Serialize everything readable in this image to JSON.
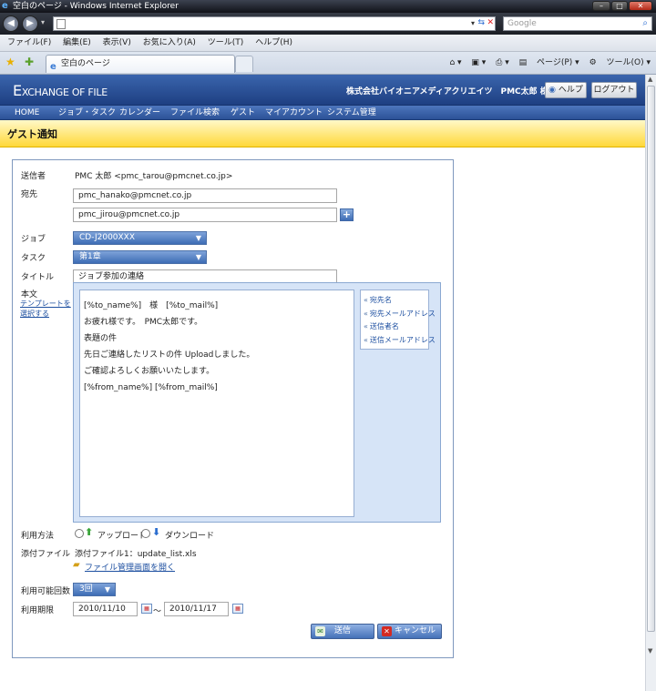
{
  "window": {
    "title": "空白のページ - Windows Internet Explorer"
  },
  "search": {
    "placeholder": "Google"
  },
  "menu": [
    "ファイル(F)",
    "編集(E)",
    "表示(V)",
    "お気に入り(A)",
    "ツール(T)",
    "ヘルプ(H)"
  ],
  "tab": {
    "label": "空白のページ"
  },
  "commandbar": {
    "page": "ページ(P)",
    "tools": "ツール(O)"
  },
  "app": {
    "logo_main": "E",
    "logo_rest": "XCHANGE OF FILE",
    "company": "株式会社バイオニアメディアクリエイツ　PMC太郎 様",
    "help": "ヘルプ",
    "logout": "ログアウト"
  },
  "nav": [
    "HOME",
    "ジョブ・タスク",
    "カレンダー",
    "ファイル検索",
    "ゲスト",
    "マイアカウント",
    "システム管理"
  ],
  "page": {
    "title": "ゲスト通知"
  },
  "form": {
    "sender_label": "送信者",
    "sender_value": "PMC 太郎 <pmc_tarou@pmcnet.co.jp>",
    "to_label": "宛先",
    "to_1": "pmc_hanako@pmcnet.co.jp",
    "to_2": "pmc_jirou@pmcnet.co.jp",
    "job_label": "ジョブ",
    "job_value": "CD-J2000XXX",
    "task_label": "タスク",
    "task_value": "第1章",
    "title_label": "タイトル",
    "title_value": "ジョブ参加の連絡",
    "body_label": "本文",
    "template_link_1": "テンプレートを",
    "template_link_2": "選択する",
    "body_lines": [
      "[%to_name%]　様　[%to_mail%]",
      "お疲れ様です。　PMC太郎です。",
      "表題の件",
      "先日ご連絡したリストの件 Uploadしました。",
      "ご確認よろしくお願いいたします。",
      "[%from_name%] [%from_mail%]"
    ],
    "insert_items": [
      "宛先名",
      "宛先メールアドレス",
      "送信者名",
      "送信メールアドレス"
    ],
    "usage_label": "利用方法",
    "upload": "アップロード",
    "download": "ダウンロード",
    "attach_label": "添付ファイル",
    "attach_value": "添付ファイル1：update_list.xls",
    "file_link": "ファイル管理画面を開く",
    "count_label": "利用可能回数",
    "count_value": "3回",
    "period_label": "利用期限",
    "date_from": "2010/11/10",
    "tilde": "～",
    "date_to": "2010/11/17",
    "send": "送信",
    "cancel": "キャンセル"
  }
}
